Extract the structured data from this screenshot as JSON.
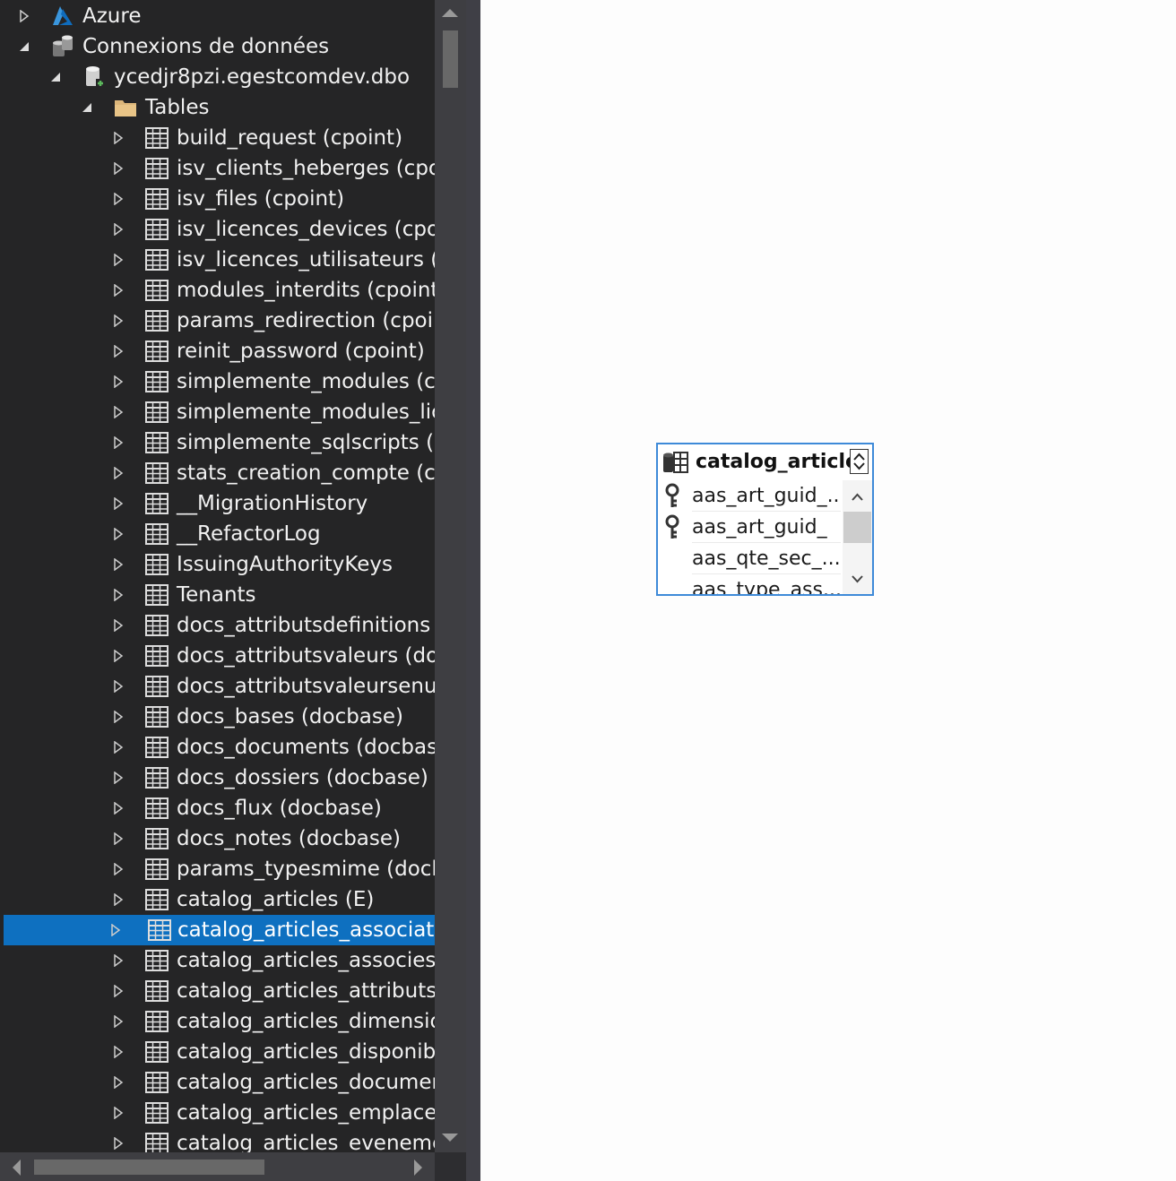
{
  "explorer": {
    "nodes": [
      {
        "label": "Azure",
        "icon": "azure-icon",
        "state": "collapsed",
        "level": 0
      },
      {
        "label": "Connexions de données",
        "icon": "data-connections-icon",
        "state": "expanded",
        "level": 0
      },
      {
        "label": "ycedjr8pzi.egestcomdev.dbo",
        "icon": "database-connection-icon",
        "state": "expanded",
        "level": 1
      },
      {
        "label": "Tables",
        "icon": "folder-icon",
        "state": "expanded",
        "level": 2
      }
    ],
    "tables": [
      "build_request (cpoint)",
      "isv_clients_heberges (cpoint)",
      "isv_files (cpoint)",
      "isv_licences_devices (cpoint)",
      "isv_licences_utilisateurs (cpoint)",
      "modules_interdits (cpoint)",
      "params_redirection (cpoint)",
      "reinit_password (cpoint)",
      "simplemente_modules (cpoint)",
      "simplemente_modules_licences",
      "simplemente_sqlscripts (cpoint)",
      "stats_creation_compte (cpoint)",
      "__MigrationHistory",
      "__RefactorLog",
      "IssuingAuthorityKeys",
      "Tenants",
      "docs_attributsdefinitions (docbase)",
      "docs_attributsvaleurs (docbase)",
      "docs_attributsvaleursenum",
      "docs_bases (docbase)",
      "docs_documents (docbase)",
      "docs_dossiers (docbase)",
      "docs_flux (docbase)",
      "docs_notes (docbase)",
      "params_typesmime (docbase)",
      "catalog_articles (E)",
      "catalog_articles_associations (E)",
      "catalog_articles_associes (E)",
      "catalog_articles_attributs (E)",
      "catalog_articles_dimensions",
      "catalog_articles_disponibilite",
      "catalog_articles_documents",
      "catalog_articles_emplacements",
      "catalog_articles_evenements"
    ],
    "selected_index": 26,
    "colors": {
      "background": "#252526",
      "text": "#f1f1f1",
      "selection": "#0e70c0"
    }
  },
  "designer": {
    "table": {
      "title": "catalog_articles_associations",
      "icon": "table-designer-icon",
      "columns": [
        {
          "name": "aas_art_guid_...",
          "key": true
        },
        {
          "name": "aas_art_guid_",
          "key": true
        },
        {
          "name": "aas_qte_sec_...",
          "key": false
        },
        {
          "name": "aas_type_ass...",
          "key": false
        }
      ]
    },
    "colors": {
      "border": "#3e8ad8",
      "canvas": "#fdfdfd"
    }
  }
}
